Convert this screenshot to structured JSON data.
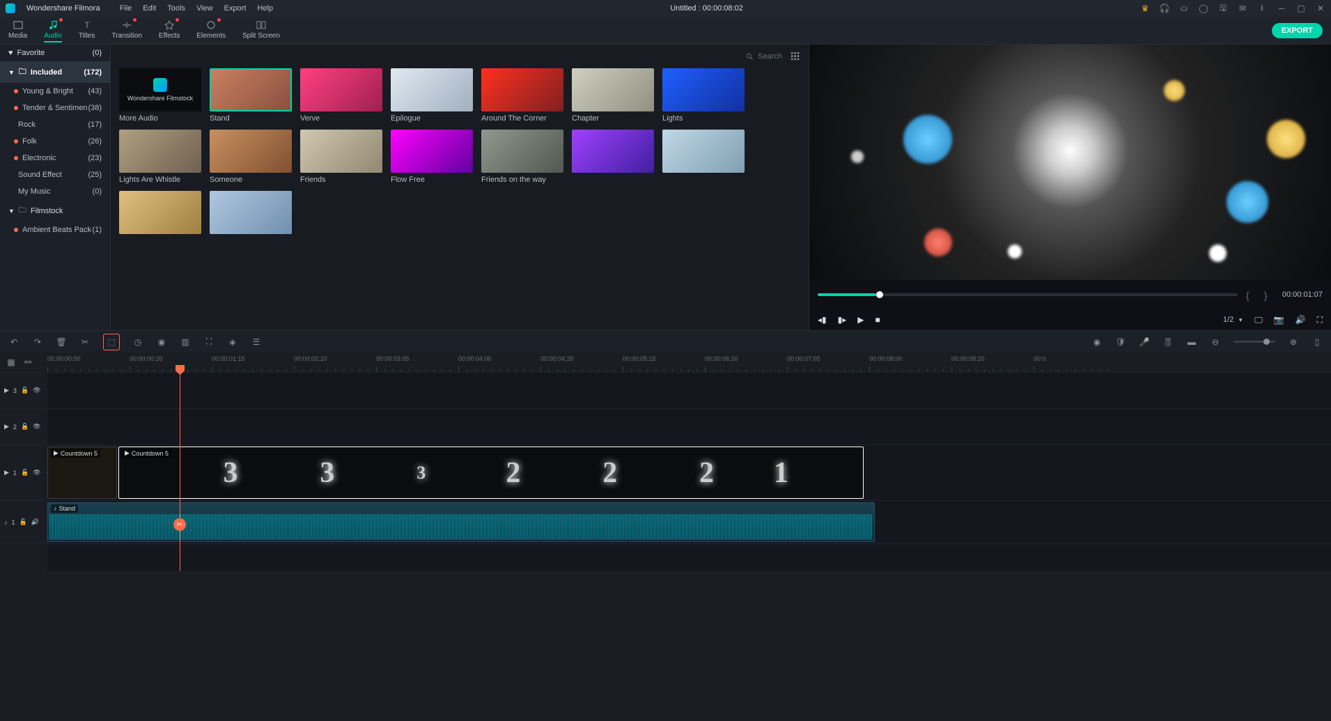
{
  "app": {
    "name": "Wondershare Filmora",
    "title": "Untitled : 00:00:08:02"
  },
  "menu": [
    "File",
    "Edit",
    "Tools",
    "View",
    "Export",
    "Help"
  ],
  "tabs": [
    {
      "label": "Media",
      "dot": false
    },
    {
      "label": "Audio",
      "dot": true
    },
    {
      "label": "Titles",
      "dot": false
    },
    {
      "label": "Transition",
      "dot": true
    },
    {
      "label": "Effects",
      "dot": true
    },
    {
      "label": "Elements",
      "dot": true
    },
    {
      "label": "Split Screen",
      "dot": false
    }
  ],
  "export_label": "EXPORT",
  "sidebar": [
    {
      "label": "Favorite",
      "count": "(0)",
      "type": "header",
      "icon": "heart"
    },
    {
      "label": "Included",
      "count": "(172)",
      "type": "folder",
      "active": true
    },
    {
      "label": "Young & Bright",
      "count": "(43)",
      "type": "sub",
      "dot": true
    },
    {
      "label": "Tender & Sentimen",
      "count": "(38)",
      "type": "sub",
      "dot": true
    },
    {
      "label": "Rock",
      "count": "(17)",
      "type": "sub",
      "dot": false
    },
    {
      "label": "Folk",
      "count": "(26)",
      "type": "sub",
      "dot": true
    },
    {
      "label": "Electronic",
      "count": "(23)",
      "type": "sub",
      "dot": true
    },
    {
      "label": "Sound Effect",
      "count": "(25)",
      "type": "sub",
      "dot": false
    },
    {
      "label": "My Music",
      "count": "(0)",
      "type": "sub",
      "dot": false
    },
    {
      "label": "Filmstock",
      "count": "",
      "type": "folder"
    },
    {
      "label": "Ambient Beats Pack",
      "count": "(1)",
      "type": "sub",
      "dot": true
    }
  ],
  "search_placeholder": "Search",
  "thumbs": [
    {
      "label": "More Audio",
      "more": true,
      "more_text": "Wondershare Filmstock"
    },
    {
      "label": "Stand",
      "selected": true,
      "bg": "linear-gradient(135deg,#c98060,#8a5040)"
    },
    {
      "label": "Verve",
      "bg": "linear-gradient(135deg,#ff4080,#a02050)"
    },
    {
      "label": "Epilogue",
      "bg": "linear-gradient(135deg,#e0e8f0,#a0b0c0)"
    },
    {
      "label": "Around The Corner",
      "bg": "linear-gradient(135deg,#ff3020,#802020)"
    },
    {
      "label": "Chapter",
      "bg": "linear-gradient(135deg,#d0d0c0,#909080)"
    },
    {
      "label": "Lights",
      "bg": "linear-gradient(135deg,#2060ff,#1030a0)"
    },
    {
      "label": "Lights Are Whistle",
      "bg": "linear-gradient(135deg,#b0a080,#706050)"
    },
    {
      "label": "Someone",
      "bg": "linear-gradient(135deg,#c89060,#805030)"
    },
    {
      "label": "Friends",
      "bg": "linear-gradient(135deg,#d0c8b0,#908870)"
    },
    {
      "label": "Flow Free",
      "bg": "linear-gradient(135deg,#ff00ff,#6000a0)"
    },
    {
      "label": "Friends on the way",
      "bg": "linear-gradient(135deg,#909890,#505850)"
    },
    {
      "label": "",
      "bg": "linear-gradient(135deg,#a040ff,#4020a0)"
    },
    {
      "label": "",
      "bg": "linear-gradient(135deg,#c0d8e8,#80a0b0)"
    },
    {
      "label": "",
      "bg": "linear-gradient(135deg,#e0c080,#a08040)"
    },
    {
      "label": "",
      "bg": "linear-gradient(135deg,#b0c8e0,#7090b0)"
    }
  ],
  "preview": {
    "timecode": "00:00:01:07",
    "zoom": "1/2"
  },
  "ruler_marks": [
    "00:00:00:00",
    "00:00:00:20",
    "00:00:01:15",
    "00:00:02:10",
    "00:00:03:05",
    "00:00:04:00",
    "00:00:04:20",
    "00:00:05:15",
    "00:00:06:10",
    "00:00:07:05",
    "00:00:08:00",
    "00:00:08:20",
    "00:0"
  ],
  "tracks": {
    "v3": "3",
    "v2": "2",
    "v1": "1",
    "a1": "1"
  },
  "clips": {
    "clip1_label": "Countdown 5",
    "clip2_label": "Countdown 5",
    "audio_label": "Stand"
  }
}
